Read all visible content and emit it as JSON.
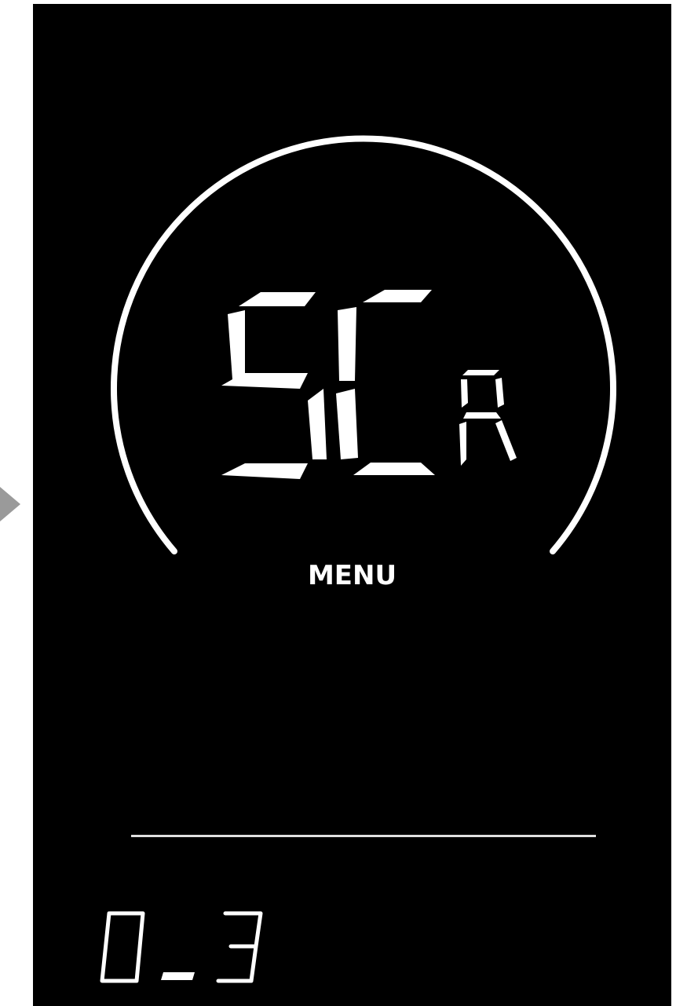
{
  "display": {
    "mode_code": "SC",
    "mode_suffix": "R",
    "menu_label": "MENU",
    "setting_value": "0.3"
  },
  "colors": {
    "background": "#000000",
    "segment": "#ffffff",
    "divider": "#e0e0e0",
    "frame": "#ffffff",
    "side_arrow": "#9a9a9a"
  },
  "icons": {
    "side_arrow": "triangle-right-icon",
    "gauge_arc": "speed-arc"
  }
}
